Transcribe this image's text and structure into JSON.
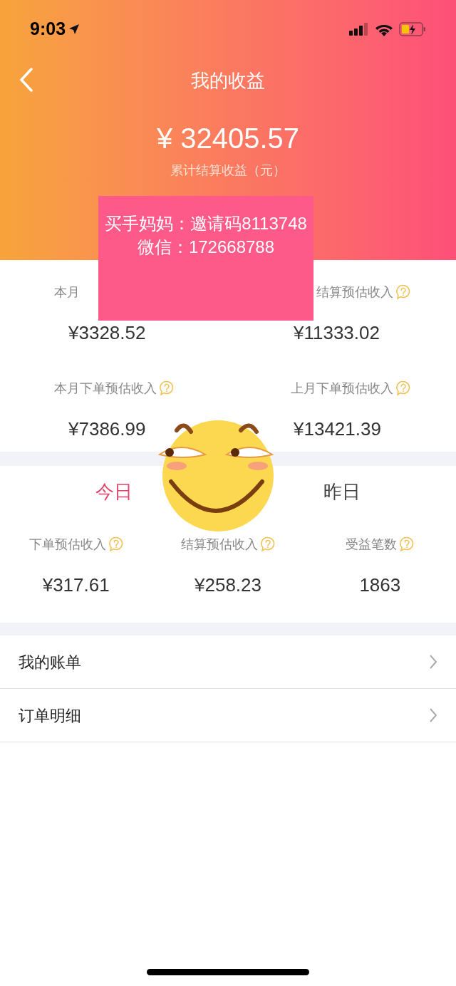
{
  "status_bar": {
    "time": "9:03"
  },
  "nav": {
    "title": "我的收益"
  },
  "total": {
    "amount": "¥ 32405.57",
    "caption": "累计结算收益（元）"
  },
  "overlay_note": {
    "lines": [
      "买手妈妈：邀请码8113748",
      "微信：172668788"
    ]
  },
  "monthly_stats": [
    {
      "label": "本月",
      "value": "¥3328.52",
      "help_icon": false
    },
    {
      "label": "结算预估收入",
      "value": "¥11333.02",
      "help_icon": true
    },
    {
      "label": "本月下单预估收入",
      "value": "¥7386.99",
      "help_icon": true
    },
    {
      "label": "上月下单预估收入",
      "value": "¥13421.39",
      "help_icon": true
    }
  ],
  "day_tabs": [
    {
      "label": "今日",
      "selected": true
    },
    {
      "label": "昨日",
      "selected": false
    }
  ],
  "day_stats": [
    {
      "label": "下单预估收入",
      "value": "¥317.61"
    },
    {
      "label": "结算预估收入",
      "value": "¥258.23"
    },
    {
      "label": "受益笔数",
      "value": "1863"
    }
  ],
  "menu": [
    {
      "label": "我的账单"
    },
    {
      "label": "订单明细"
    }
  ]
}
